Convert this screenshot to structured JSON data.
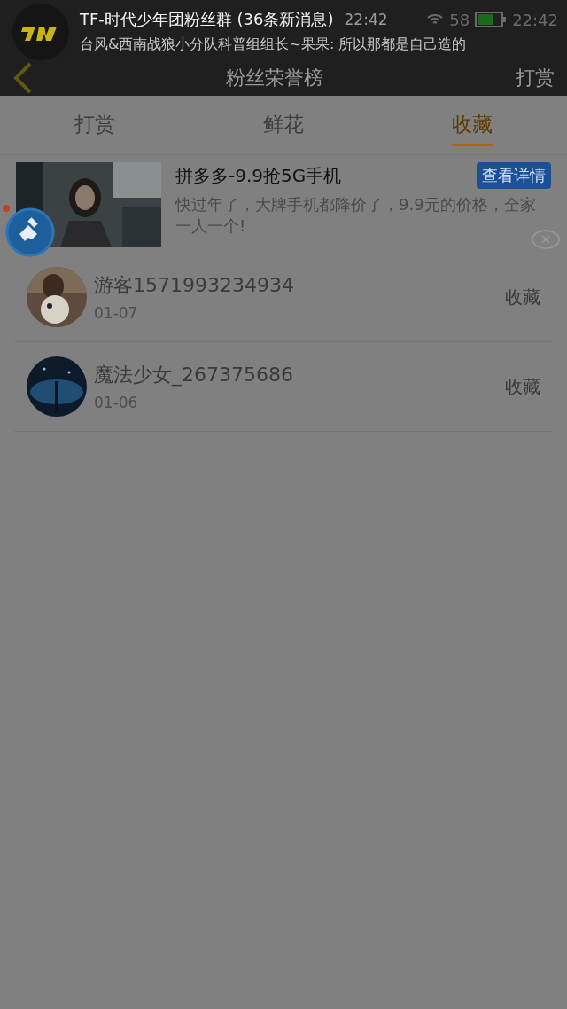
{
  "status_bar": {
    "battery": "58",
    "time": "22:42"
  },
  "notification": {
    "title": "TF-时代少年团粉丝群 (36条新消息)",
    "time": "22:42",
    "message": "台风&西南战狼小分队科普组组长~果果: 所以那都是自己造的"
  },
  "header": {
    "title": "粉丝荣誉榜",
    "action": "打赏"
  },
  "tabs": [
    {
      "label": "打赏",
      "selected": false
    },
    {
      "label": "鲜花",
      "selected": false
    },
    {
      "label": "收藏",
      "selected": true
    }
  ],
  "ad": {
    "kind": "picture",
    "title": "拼多多-9.9抢5G手机",
    "button": "查看详情",
    "description": "快过年了，大牌手机都降价了，9.9元的价格，全家一人一个!"
  },
  "list": [
    {
      "name": "游客1571993234934",
      "date": "01-07",
      "action": "收藏"
    },
    {
      "name": "魔法少女_267375686",
      "date": "01-06",
      "action": "收藏"
    }
  ]
}
